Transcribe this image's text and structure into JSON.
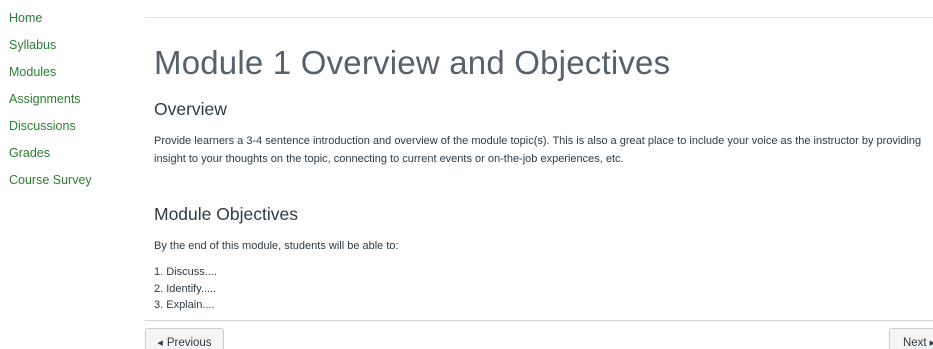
{
  "course_nav": {
    "items": [
      {
        "label": "Home"
      },
      {
        "label": "Syllabus"
      },
      {
        "label": "Modules"
      },
      {
        "label": "Assignments"
      },
      {
        "label": "Discussions"
      },
      {
        "label": "Grades"
      },
      {
        "label": "Course Survey"
      }
    ],
    "link_color": "#2d7d32"
  },
  "page": {
    "title": "Module 1 Overview and Objectives",
    "overview": {
      "heading": "Overview",
      "text": "Provide learners a 3-4 sentence introduction and overview of the module topic(s). This is also a great place to include your voice as the instructor by providing insight to your thoughts on the topic, connecting to current events or on-the-job experiences, etc."
    },
    "objectives": {
      "heading": "Module Objectives",
      "intro": "By the end of this module, students will be able to:",
      "items": [
        "1. Discuss....",
        "2. Identify.....",
        "3. Explain...."
      ]
    }
  },
  "footer_nav": {
    "previous_label": "Previous",
    "next_label": "Next",
    "previous_icon": "caret-left-icon",
    "next_icon": "caret-right-icon"
  }
}
